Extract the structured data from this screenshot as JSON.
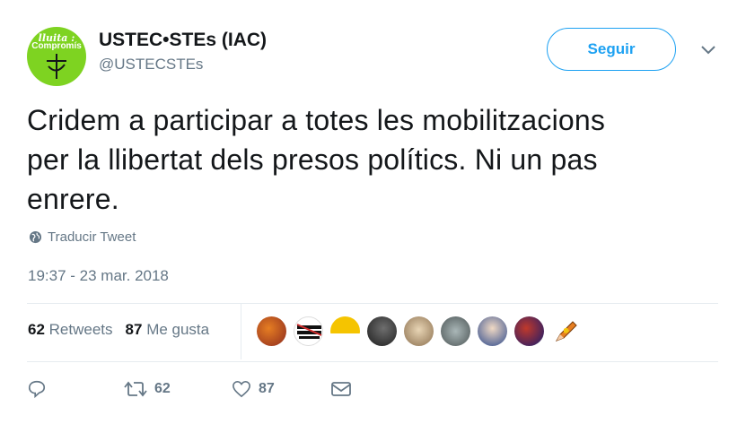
{
  "user": {
    "name": "USTEC•STEs (IAC)",
    "handle": "@USTECSTEs",
    "avatar_text_top": "lluita :",
    "avatar_text_mid": "Compromís"
  },
  "follow_label": "Seguir",
  "tweet": {
    "line1": "Cridem a participar a totes les mobilitzacions",
    "line2": "per la llibertat dels presos polítics. Ni un pas",
    "line3": "enrere."
  },
  "translate_label": "Traducir Tweet",
  "timestamp": "19:37 - 23 mar. 2018",
  "stats": {
    "retweets_count": "62",
    "retweets_label": "Retweets",
    "likes_count": "87",
    "likes_label": "Me gusta"
  },
  "liker_avatars": [
    {
      "icon": "avatar-photo-1",
      "color": "#c0392b"
    },
    {
      "icon": "avatar-llibertat-presos-politics",
      "color": "#ffffff",
      "text": "LLIBERTAT PRESOS POLÍTICS!"
    },
    {
      "icon": "avatar-yellow-sun",
      "color": "#f5c400"
    },
    {
      "icon": "avatar-photo-4",
      "color": "#2c2c2c"
    },
    {
      "icon": "avatar-photo-5",
      "color": "#b5a38a"
    },
    {
      "icon": "avatar-photo-6",
      "color": "#7f8c8d"
    },
    {
      "icon": "avatar-photo-7",
      "color": "#3b5998"
    },
    {
      "icon": "avatar-photo-8",
      "color": "#6c3483"
    },
    {
      "icon": "avatar-pencil-ribbon",
      "color": "#f1c40f"
    }
  ],
  "actions": {
    "reply_icon": "reply-icon",
    "retweet_count": "62",
    "like_count": "87",
    "dm_icon": "envelope-icon"
  },
  "colors": {
    "accent": "#1da1f2",
    "secondary_text": "#657786",
    "avatar_green": "#7ed321"
  }
}
